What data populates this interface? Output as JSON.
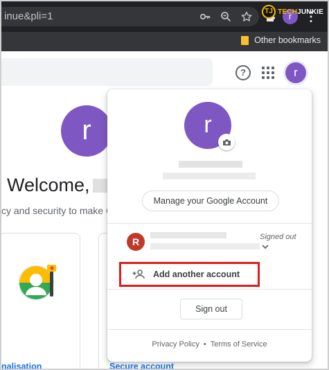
{
  "browser": {
    "url_text": "inue&pli=1",
    "bookmarks": {
      "other_label": "Other bookmarks"
    },
    "profile_initial": "r",
    "menu_glyph": "⋮"
  },
  "watermark": {
    "badge": "TJ",
    "text_tech": "TECH",
    "text_rest": "JUNKIE"
  },
  "page": {
    "avatar_initial": "r",
    "big_avatar_initial": "r",
    "welcome": "Welcome,",
    "subtext": "cy and security to make G",
    "card_left_link": "nalisation",
    "card_right_link": "Secure account",
    "help_glyph": "?"
  },
  "popup": {
    "avatar_initial": "r",
    "manage_label": "Manage your Google Account",
    "account_initial": "R",
    "signed_out_label": "Signed out",
    "add_account_label": "Add another account",
    "sign_out_label": "Sign out",
    "privacy_label": "Privacy Policy",
    "separator": "•",
    "terms_label": "Terms of Service"
  },
  "colors": {
    "avatar_purple": "#7e57c2",
    "account_red": "#c0392b",
    "highlight_red": "#e01b1b",
    "link_blue": "#1a73e8"
  },
  "icons": [
    "key-icon",
    "zoom-icon",
    "star-icon",
    "puzzle-icon",
    "help-icon",
    "apps-grid-icon",
    "camera-icon",
    "chevron-down-icon",
    "add-person-icon",
    "folder-icon"
  ]
}
